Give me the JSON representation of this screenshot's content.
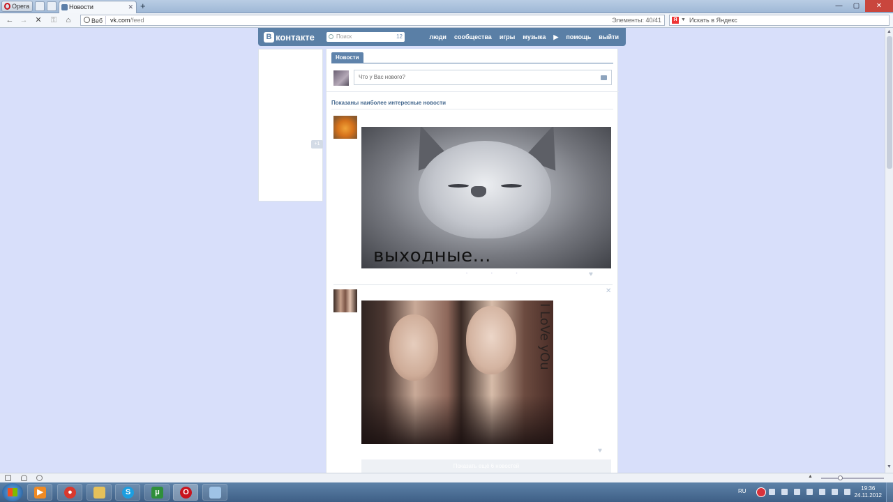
{
  "browser": {
    "menu_label": "Opera",
    "tab_title": "Новости",
    "new_tab": "+",
    "url_badge": "Веб",
    "url_host": "vk.com",
    "url_path": "/feed",
    "elements_label": "Элементы:",
    "elements_count": "40/41",
    "search_placeholder": "Искать в Яндекс"
  },
  "vk": {
    "logo_text": "контакте",
    "logo_letter": "В",
    "search_placeholder": "Поиск",
    "search_count": "12",
    "menu": {
      "people": "люди",
      "communities": "сообщества",
      "games": "игры",
      "music": "музыка",
      "help": "помощь",
      "logout": "выйти"
    },
    "left_badge": "+1",
    "tab_news": "Новости",
    "post_placeholder": "Что у Вас нового?",
    "shown_title": "Показаны наиболее интересные новости",
    "posts": [
      {
        "image_caption": "выходные..."
      },
      {
        "image_caption": "I LoVe yOu"
      }
    ],
    "more_label": "Показать ещё 6 новостей"
  },
  "taskbar": {
    "lang": "RU",
    "time": "19:36",
    "date": "24.11.2012"
  },
  "icons": [
    "opera-icon",
    "back-icon",
    "forward-icon",
    "stop-icon",
    "key-icon",
    "home-icon",
    "globe-icon",
    "yandex-icon",
    "search-icon",
    "camera-icon",
    "heart-icon",
    "close-icon",
    "windows-start-icon",
    "media-player-icon",
    "chrome-icon",
    "explorer-icon",
    "skype-icon",
    "utorrent-icon",
    "record-icon",
    "volume-icon"
  ],
  "colors": {
    "vk_header": "#5a7fa6",
    "page_bg": "#d8dffa",
    "link": "#45688e"
  }
}
